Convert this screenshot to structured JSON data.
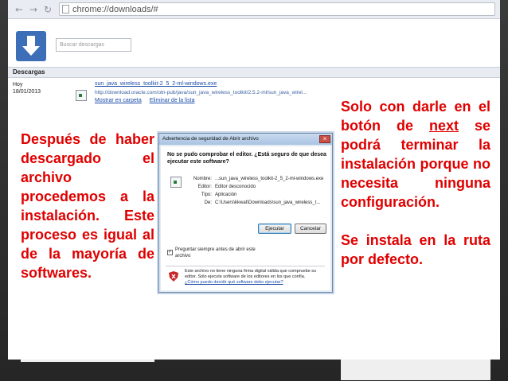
{
  "browser": {
    "url": "chrome://downloads/#",
    "back_icon": "back-arrow-icon",
    "forward_icon": "forward-arrow-icon",
    "reload_icon": "reload-icon"
  },
  "downloads_page": {
    "search_placeholder": "Buscar descargas",
    "section_title": "Descargas",
    "day_label": "Hoy",
    "date": "18/01/2013",
    "file_name": "sun_java_wireless_toolkit-2_5_2-ml-windows.exe",
    "file_url": "http://download.oracle.com/otn-pub/java/sun_java_wireless_toolkit/2.5.2-ml/sun_java_wirel...",
    "show_in_folder": "Mostrar en carpeta",
    "remove_from_list": "Eliminar de la lista"
  },
  "dialog": {
    "title": "Advertencia de seguridad de Abrir archivo",
    "heading": "No se pudo comprobar el editor. ¿Está seguro de que desea ejecutar este software?",
    "fields": [
      {
        "key": "Nombre:",
        "value": "...sun_java_wireless_toolkit-2_5_2-ml-windows.exe"
      },
      {
        "key": "Editor:",
        "value": "Editor desconocido"
      },
      {
        "key": "Tipo:",
        "value": "Aplicación"
      },
      {
        "key": "De:",
        "value": "C:\\Users\\kkwat\\Downloads\\sun_java_wireless_t..."
      }
    ],
    "run_button": "Ejecutar",
    "cancel_button": "Cancelar",
    "checkbox_label": "Preguntar siempre antes de abrir este archivo",
    "footer_text": "Este archivo no tiene ninguna firma digital válida que compruebe su editor. Sólo ejecute software de los editores en los que confía.",
    "footer_link": "¿Cómo puedo decidir qué software debo ejecutar?"
  },
  "annotations": {
    "left": "Después de haber descargado el archivo procedemos a la instalación. Este proceso es igual al de la mayoría de softwares.",
    "right_1_prefix": "Solo con darle en el botón de",
    "right_1_underlined": "next",
    "right_1_suffix": "se podrá terminar la instalación porque no necesita ninguna configuración.",
    "right_2": "Se instala en la ruta por defecto."
  },
  "colors": {
    "annotation_text": "#e00000",
    "logo_blue": "#3d6fb8",
    "link_blue": "#1a4ca8"
  }
}
